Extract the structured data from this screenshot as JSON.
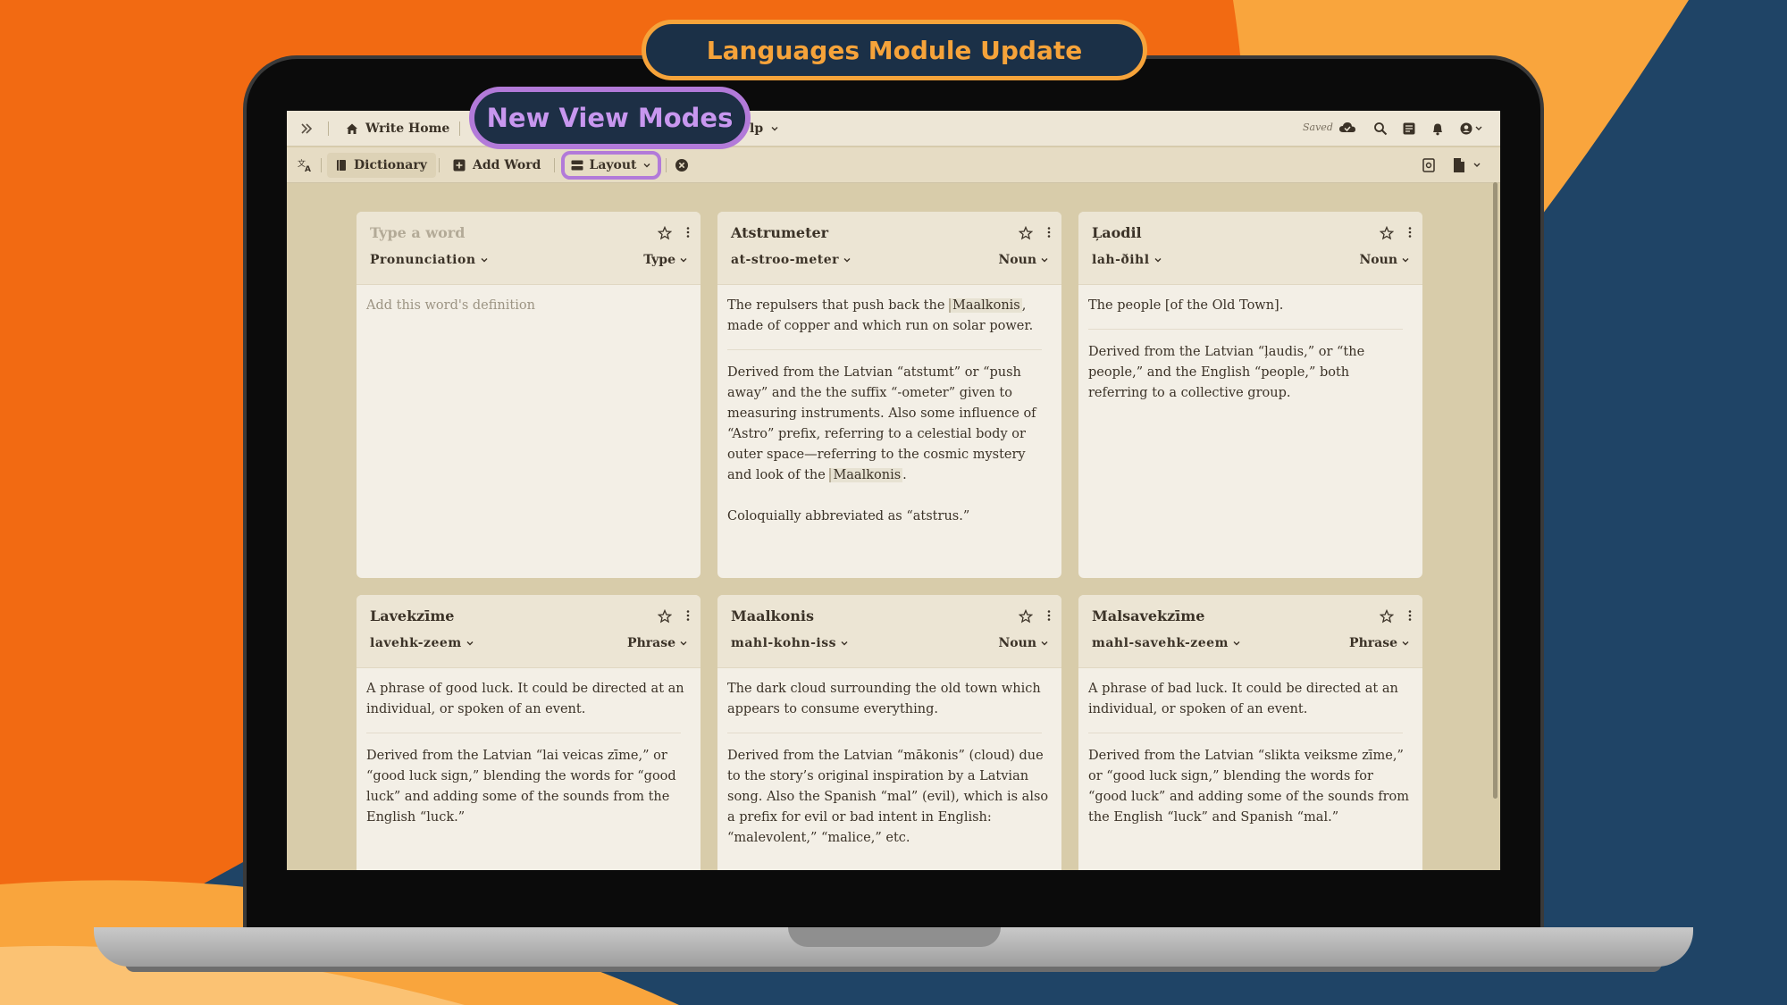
{
  "callouts": {
    "header": "Languages Module Update",
    "highlight": "New View Modes"
  },
  "topbar": {
    "home_label": "Write Home",
    "help_fragment": "lp",
    "saved_label": "Saved"
  },
  "toolbar": {
    "dictionary_label": "Dictionary",
    "add_word_label": "Add Word",
    "layout_label": "Layout"
  },
  "cards": [
    {
      "word": "Type a word",
      "pronunciation": "Pronunciation",
      "type": "Type",
      "definition": "Add this word's definition"
    },
    {
      "word": "Atstrumeter",
      "pronunciation": "at-stroo-meter",
      "type": "Noun",
      "p1_a": "The repulsers that push back the ",
      "p1_link": "Maalkonis",
      "p1_b": ", made of copper and which run on solar power.",
      "p2_a": "Derived from the Latvian “atstumt” or “push away” and the the suffix “-ometer” given to measuring instruments. Also some influence of “Astro” prefix, referring to a celestial body or outer space—referring to the cosmic mystery and look of the ",
      "p2_link": "Maalkonis",
      "p2_b": ".",
      "p3": "Coloquially abbreviated as “atstrus.”"
    },
    {
      "word": "Ļaodil",
      "pronunciation": "lah-ðihl",
      "type": "Noun",
      "p1": "The people [of the Old Town].",
      "p2": "Derived from the Latvian “ļaudis,” or “the people,” and the English “people,” both referring to a collective group."
    },
    {
      "word": "Lavekzīme",
      "pronunciation": "lavehk-zeem",
      "type": "Phrase",
      "p1": "A phrase of good luck. It could be directed at an individual, or spoken of an event.",
      "p2": "Derived from the Latvian “lai veicas zīme,” or “good luck sign,” blending the words for “good luck” and adding some of the sounds from the English “luck.”"
    },
    {
      "word": "Maalkonis",
      "pronunciation": "mahl-kohn-iss",
      "type": "Noun",
      "p1": "The dark cloud surrounding the old town which appears to consume everything.",
      "p2": "Derived from the Latvian “mākonis” (cloud) due to the story’s original inspiration by a Latvian song. Also the Spanish “mal” (evil), which is also a prefix for evil or bad intent in English: “malevolent,” “malice,” etc."
    },
    {
      "word": "Malsavekzīme",
      "pronunciation": "mahl-savehk-zeem",
      "type": "Phrase",
      "p1": "A phrase of bad luck. It could be directed at an individual, or spoken of an event.",
      "p2": "Derived from the Latvian “slikta veiksme zīme,” or “good luck sign,” blending the words for “good luck” and adding some of the sounds from the English “luck” and Spanish “mal.”"
    }
  ],
  "icons": {
    "expand": "double-chevron-right-icon",
    "home": "home-icon",
    "cloud": "cloud-check-icon",
    "search": "search-icon",
    "notes": "notes-icon",
    "bell": "bell-icon",
    "account": "account-icon",
    "translate": "translate-icon",
    "dictionary": "book-icon",
    "add": "plus-square-icon",
    "layout": "layout-icon",
    "close": "close-circle-icon",
    "copy": "copy-icon",
    "document": "document-icon",
    "star": "star-icon",
    "menu": "kebab-menu-icon"
  },
  "colors": {
    "orange": "#f26a12",
    "orange_light": "#f9a53d",
    "navy": "#1f4466",
    "callout_purple": "#b27ad9",
    "callout_orange": "#f6a33a",
    "paper": "#f3efe6",
    "app_bg": "#d8ccaa"
  }
}
